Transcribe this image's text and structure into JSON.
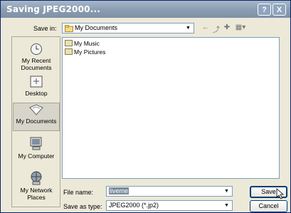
{
  "window": {
    "title": "Saving JPEG2000...",
    "help_label": "?",
    "close_label": "X"
  },
  "save_in": {
    "label": "Save in:",
    "value": "My Documents"
  },
  "places": [
    {
      "label": "My Recent Documents"
    },
    {
      "label": "Desktop"
    },
    {
      "label": "My Documents"
    },
    {
      "label": "My Computer"
    },
    {
      "label": "My Network Places"
    }
  ],
  "files": [
    {
      "name": "My Music"
    },
    {
      "name": "My Pictures"
    }
  ],
  "file_name": {
    "label": "File name:",
    "value": "liveme"
  },
  "save_as_type": {
    "label": "Save as type:",
    "value": "JPEG2000 (*.jp2)"
  },
  "buttons": {
    "save": "Save",
    "cancel": "Cancel"
  }
}
